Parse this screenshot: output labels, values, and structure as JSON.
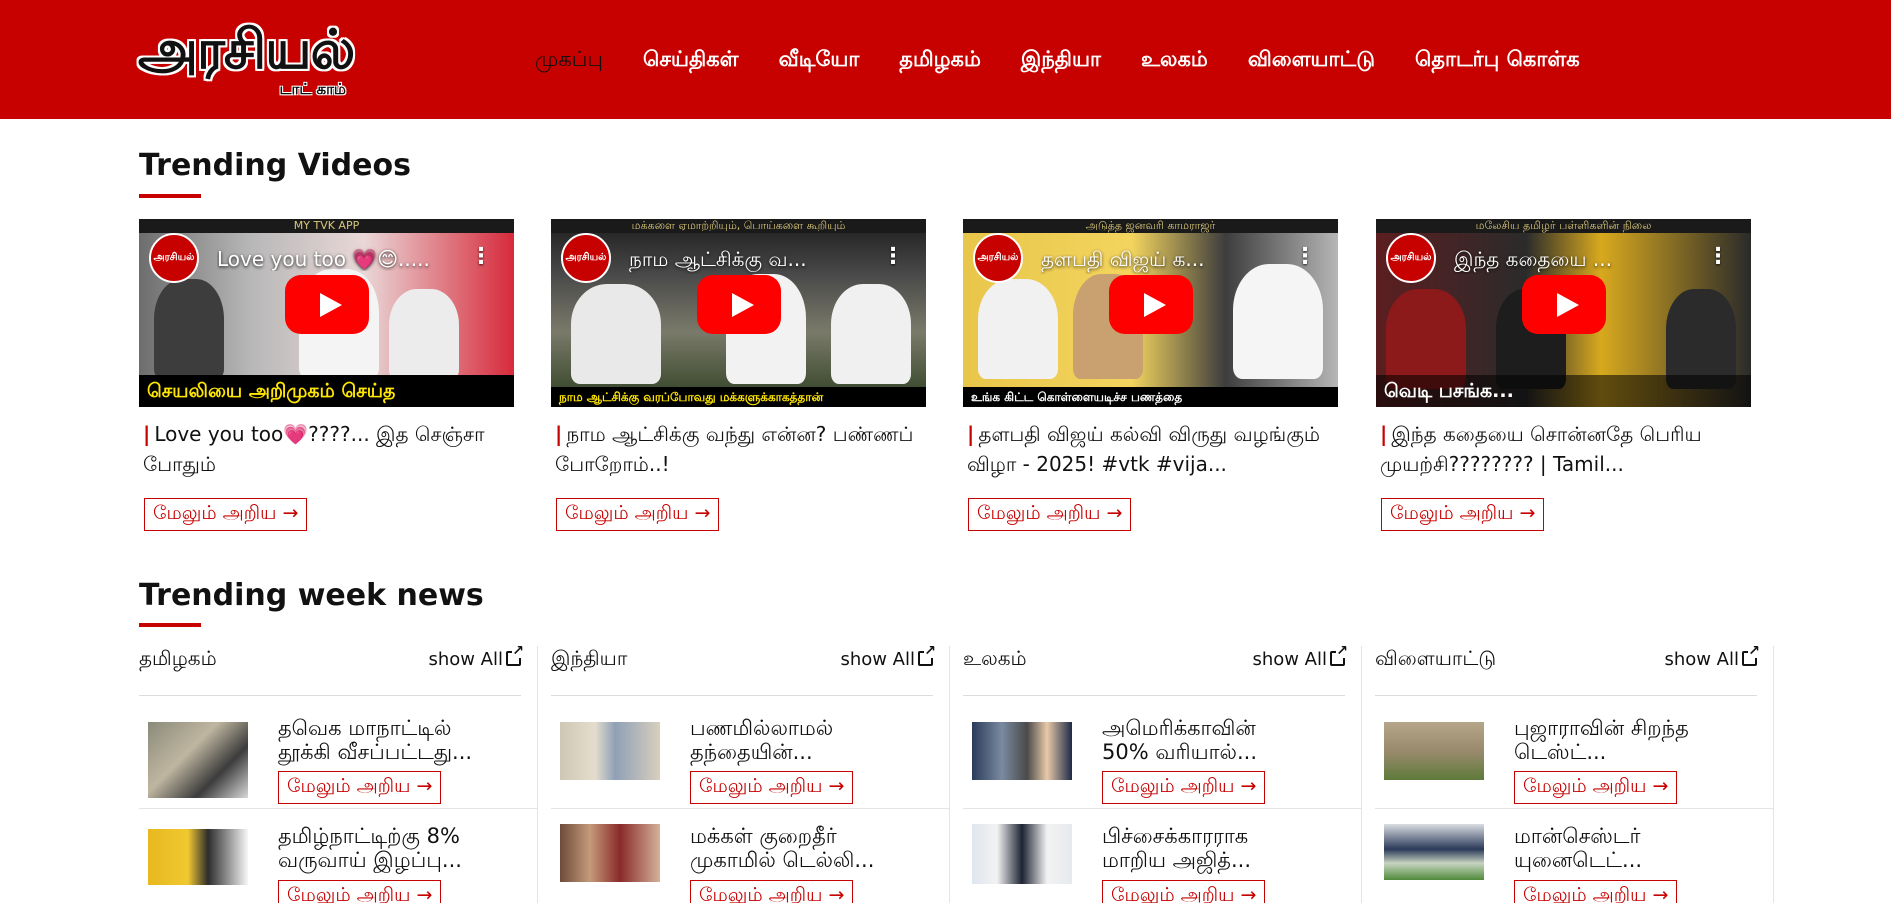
{
  "logo": {
    "main": "அரசியல்",
    "sub": "டாட் காம்"
  },
  "nav": [
    {
      "label": "முகப்பு"
    },
    {
      "label": "செய்திகள்"
    },
    {
      "label": "வீடியோ"
    },
    {
      "label": "தமிழகம்"
    },
    {
      "label": "இந்தியா"
    },
    {
      "label": "உலகம்"
    },
    {
      "label": "விளையாட்டு"
    },
    {
      "label": "தொடர்பு கொள்க"
    }
  ],
  "trending_videos": {
    "title": "Trending Videos",
    "items": [
      {
        "overlay_title": "Love you too 💗😊.....",
        "thumb_top": "MY TVK APP",
        "caption": "செயலியை அறிமுகம் செய்த",
        "title": "Love you too💗????... இத செஞ்சா போதும்",
        "more": "மேலும் அறிய →"
      },
      {
        "overlay_title": "நாம ஆட்சிக்கு வ...",
        "thumb_top": "மக்களை ஏமாற்றியும், பொய்களை கூறியும்",
        "caption": "நாம ஆட்சிக்கு வரப்போவது மக்களுக்காகத்தான்",
        "title": "நாம ஆட்சிக்கு வந்து என்ன? பண்ணப் போறோம்..!",
        "more": "மேலும் அறிய →"
      },
      {
        "overlay_title": "தளபதி விஜய் க...",
        "thumb_top": "அடுத்த ஜனவரி காமராஜர்",
        "caption": "உங்க கிட்ட கொள்ளையடிச்ச பணத்தை",
        "title": "தளபதி விஜய் கல்வி விருது வழங்கும் விழா - 2025! #vtk #vija...",
        "more": "மேலும் அறிய →"
      },
      {
        "overlay_title": "இந்த கதையை ...",
        "thumb_top": "மலேசிய தமிழர் பள்ளிகளின் நிலை",
        "caption": "வெடி பசங்க...",
        "title": "இந்த கதையை சொன்னதே பெரிய முயற்சி???????? | Tamil...",
        "more": "மேலும் அறிய →"
      }
    ]
  },
  "trending_week": {
    "title": "Trending week news",
    "show_all": "show All",
    "columns": [
      {
        "name": "தமிழகம்",
        "items": [
          {
            "line1": "தவெக மாநாட்டில்",
            "line2": "தூக்கி வீசப்பட்டது...",
            "more": "மேலும் அறிய →"
          },
          {
            "line1": "தமிழ்நாட்டிற்கு 8%",
            "line2": "வருவாய் இழப்பு...",
            "more": "மேலும் அறிய →"
          }
        ]
      },
      {
        "name": "இந்தியா",
        "items": [
          {
            "line1": "பணமில்லாமல்",
            "line2": "தந்தையின்...",
            "more": "மேலும் அறிய →"
          },
          {
            "line1": "மக்கள் குறைதீர்",
            "line2": "முகாமில் டெல்லி...",
            "more": "மேலும் அறிய →"
          }
        ]
      },
      {
        "name": "உலகம்",
        "items": [
          {
            "line1": "அமெரிக்காவின்",
            "line2": "50% வரியால்...",
            "more": "மேலும் அறிய →"
          },
          {
            "line1": "பிச்சைக்காரராக",
            "line2": "மாறிய அஜித்...",
            "more": "மேலும் அறிய →"
          }
        ]
      },
      {
        "name": "விளையாட்டு",
        "items": [
          {
            "line1": "புஜாராவின் சிறந்த",
            "line2": "டெஸ்ட்...",
            "more": "மேலும் அறிய →"
          },
          {
            "line1": "மான்செஸ்டர்",
            "line2": "யுனைடெட்...",
            "more": "மேலும் அறிய →"
          }
        ]
      }
    ]
  },
  "colors": {
    "brand_red": "#c70000",
    "youtube_red": "#ff0000",
    "caption_yellow": "#ffe600"
  }
}
